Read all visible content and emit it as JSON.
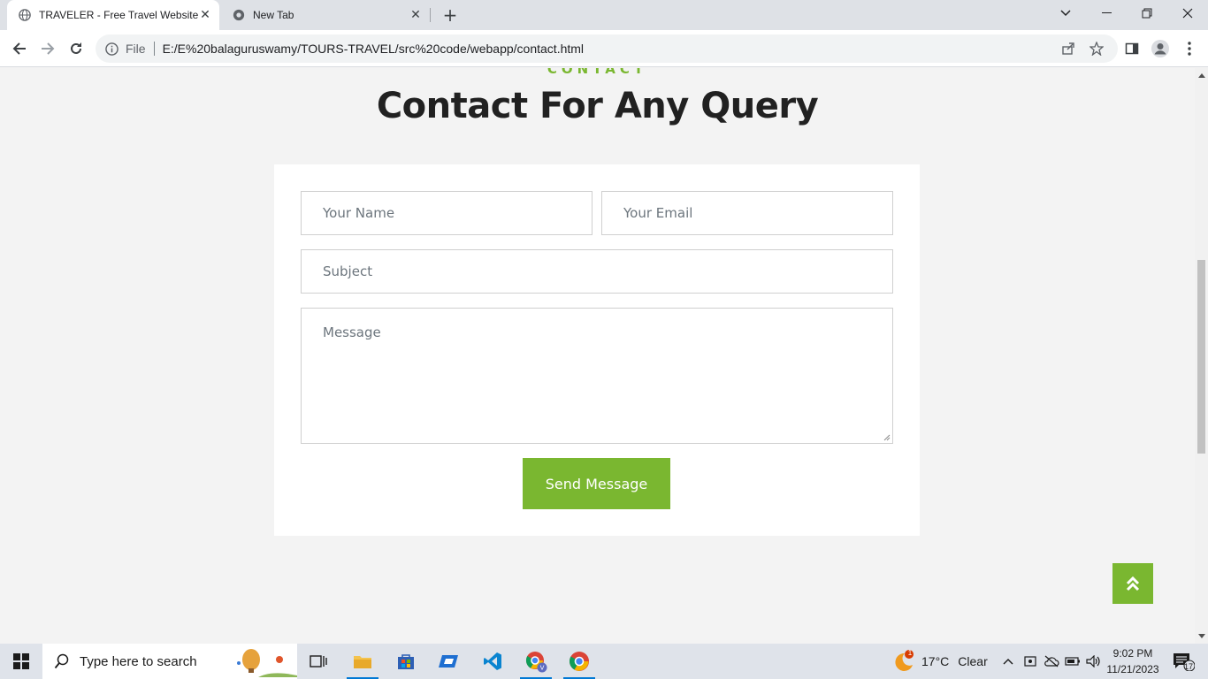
{
  "browser": {
    "tabs": [
      {
        "title": "TRAVELER - Free Travel Website",
        "active": true
      },
      {
        "title": "New Tab",
        "active": false
      }
    ],
    "address": {
      "scheme_label": "File",
      "url": "E:/E%20balaguruswamy/TOURS-TRAVEL/src%20code/webapp/contact.html"
    }
  },
  "page": {
    "eyebrow": "CONTACT",
    "heading": "Contact For Any Query",
    "form": {
      "name_placeholder": "Your Name",
      "email_placeholder": "Your Email",
      "subject_placeholder": "Subject",
      "message_placeholder": "Message",
      "submit_label": "Send Message"
    },
    "accent_color": "#7ab730"
  },
  "taskbar": {
    "search_placeholder": "Type here to search",
    "weather": {
      "temp": "17°C",
      "condition": "Clear",
      "badge": "1"
    },
    "clock": {
      "time": "9:02 PM",
      "date": "11/21/2023"
    },
    "notifications_count": "17"
  }
}
